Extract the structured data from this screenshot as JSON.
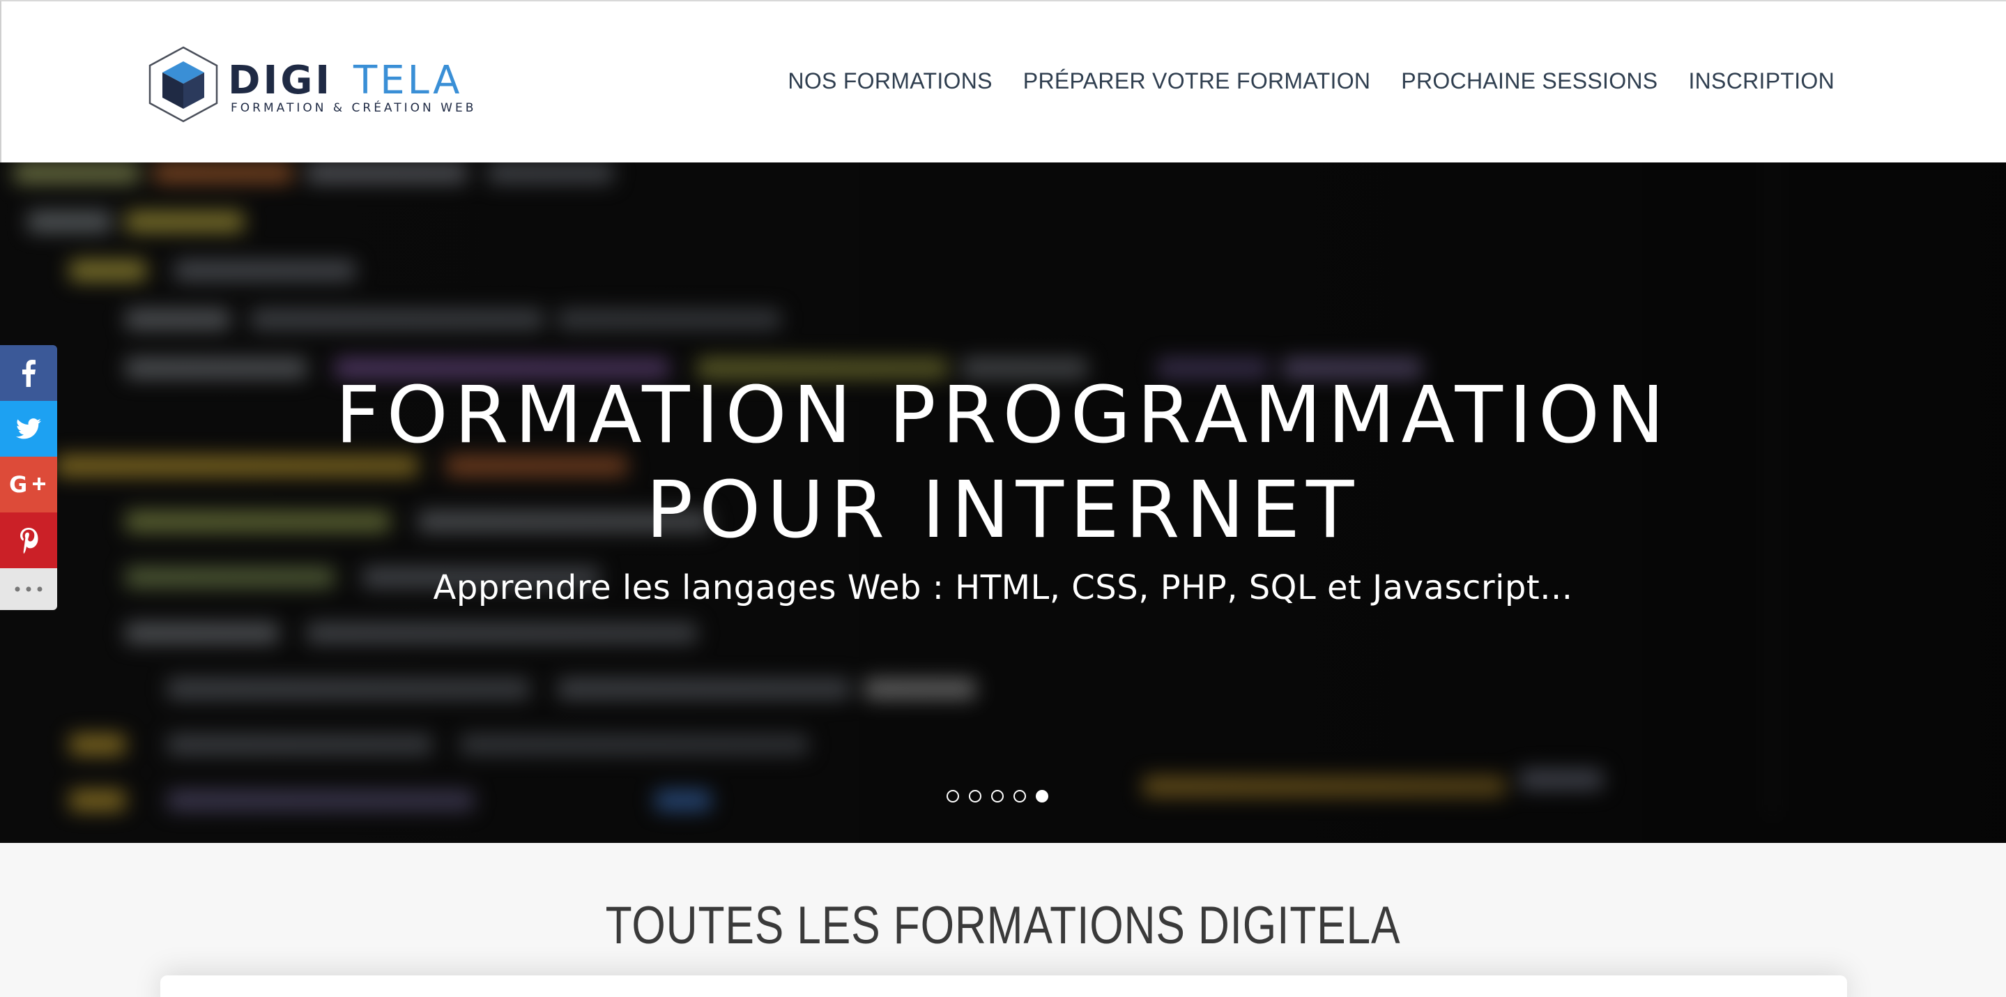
{
  "header": {
    "logo": {
      "name_part1": "DIGI",
      "name_part2": "TELA",
      "tagline": "FORMATION & CRÉATION WEB",
      "colors": {
        "dark": "#1f2a44",
        "accent": "#3a8fd6"
      }
    },
    "nav": [
      {
        "label": "NOS FORMATIONS"
      },
      {
        "label": "PRÉPARER VOTRE FORMATION"
      },
      {
        "label": "PROCHAINE SESSIONS"
      },
      {
        "label": "INSCRIPTION"
      }
    ]
  },
  "hero": {
    "title": "FORMATION PROGRAMMATION\nPOUR INTERNET",
    "subtitle": "Apprendre les langages Web : HTML, CSS, PHP, SQL et Javascript...",
    "slides_total": 5,
    "active_slide": 5
  },
  "share": {
    "buttons": [
      {
        "network": "facebook",
        "icon": "facebook-icon",
        "color": "#3b5998"
      },
      {
        "network": "twitter",
        "icon": "twitter-icon",
        "color": "#1da1f2"
      },
      {
        "network": "google-plus",
        "icon": "google-plus-icon",
        "color": "#dd4b39"
      },
      {
        "network": "pinterest",
        "icon": "pinterest-icon",
        "color": "#cb2027"
      },
      {
        "network": "more",
        "icon": "more-dots-icon",
        "color": "#e6e6e6"
      }
    ]
  },
  "section": {
    "title": "TOUTES LES FORMATIONS DIGITELA"
  }
}
